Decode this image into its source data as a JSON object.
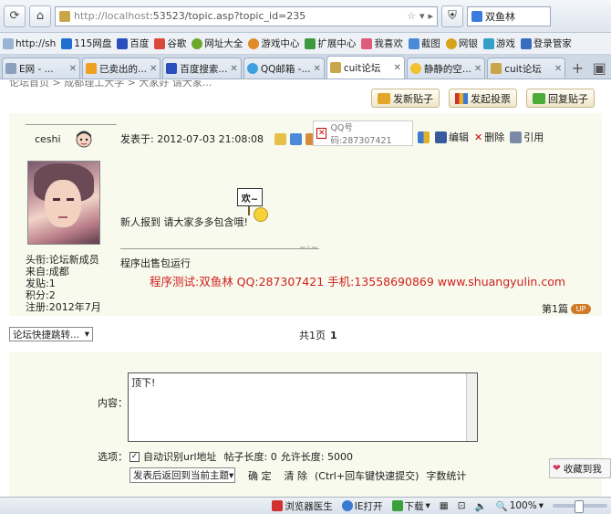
{
  "browser": {
    "url_host": "http://localhost",
    "url_rest": ":53523/topic.asp?topic_id=235",
    "search_text": "双鱼林",
    "bookmarks": [
      "http://sh",
      "115网盘",
      "百度",
      "谷歌",
      "网址大全",
      "游戏中心",
      "扩展中心",
      "我喜欢",
      "截图",
      "网银",
      "游戏",
      "登录管家"
    ],
    "tabs": [
      "E网 - ...",
      "已卖出的...",
      "百度搜索...",
      "QQ邮箱 -...",
      "cuit论坛",
      "静静的空...",
      "cuit论坛"
    ],
    "active_tab_index": 4,
    "status_items": [
      "浏览器医生",
      "IE打开",
      "下载",
      "100%"
    ]
  },
  "page": {
    "breadcrumb": "论坛首页 > 成都理工大学 > 大家好 请大家...",
    "actions": [
      "发新贴子",
      "发起投票",
      "回复贴子"
    ],
    "post": {
      "username": "ceshi",
      "user_info": [
        "头衔:论坛新成员",
        "来自:成都",
        "发贴:1",
        "积分:2",
        "注册:2012年7月"
      ],
      "posted_at": "发表于: 2012-07-03 21:08:08",
      "qq_label": "QQ号码:287307421",
      "tools": [
        "编辑",
        "删除",
        "引用"
      ],
      "sign_text": "欢~",
      "content": "新人报到 请大家多多包含哦!",
      "signature": "程序出售包运行",
      "banner": "程序测试:双鱼林 QQ:287307421 手机:13558690869 www.shuangyulin.com",
      "floor": "第1篇",
      "floor_badge": "UP"
    },
    "jump_label": "论坛快捷跳转...",
    "pager_label": "共1页",
    "pager_current": "1",
    "reply": {
      "content_label": "内容：",
      "content_value": "顶下!",
      "options_label": "选项：",
      "option_auto_url": "自动识别url地址",
      "post_length": "帖子长度: 0",
      "allowed_length": "允许长度: 5000",
      "return_select": "发表后返回到当前主题",
      "confirm": "确 定",
      "clear": "清 除",
      "shortcut_hint": "(Ctrl+回车键快速提交)",
      "word_count": "字数统计"
    },
    "favorite": "收藏到我"
  }
}
